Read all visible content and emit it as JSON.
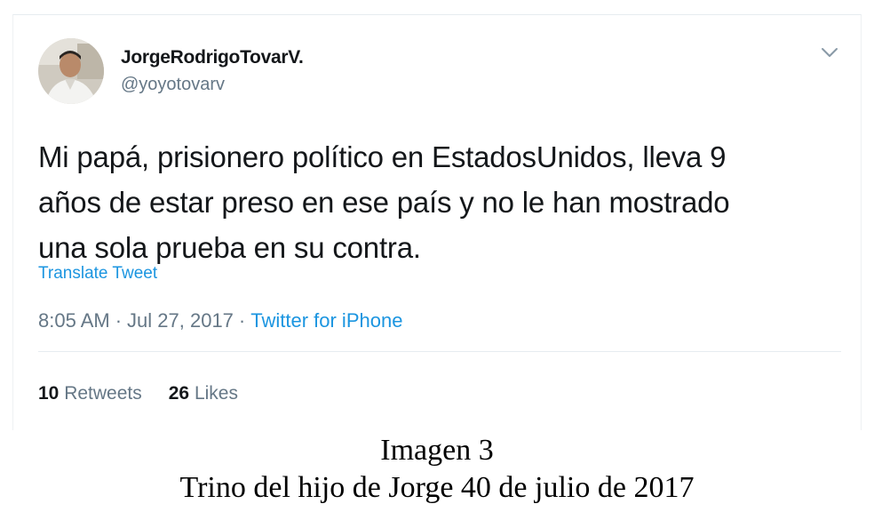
{
  "tweet": {
    "user": {
      "display_name": "JorgeRodrigoTovarV.",
      "handle": "@yoyotovarv"
    },
    "text_lines": [
      "Mi papá, prisionero político en EstadosUnidos, lleva 9",
      "años de estar preso en ese país y no le han mostrado",
      "una sola prueba en su contra."
    ],
    "translate_label": "Translate Tweet",
    "time": "8:05 AM",
    "separator": "·",
    "date": "Jul 27, 2017",
    "source": "Twitter for iPhone",
    "stats": {
      "retweets_count": "10",
      "retweets_label": "Retweets",
      "likes_count": "26",
      "likes_label": "Likes"
    },
    "menu_icon": "chevron-down-icon",
    "colors": {
      "link": "#1b95e0",
      "text": "#14171a",
      "secondary": "#657786"
    }
  },
  "caption": {
    "title": "Imagen 3",
    "subtitle": "Trino del hijo de Jorge 40 de julio de 2017"
  }
}
